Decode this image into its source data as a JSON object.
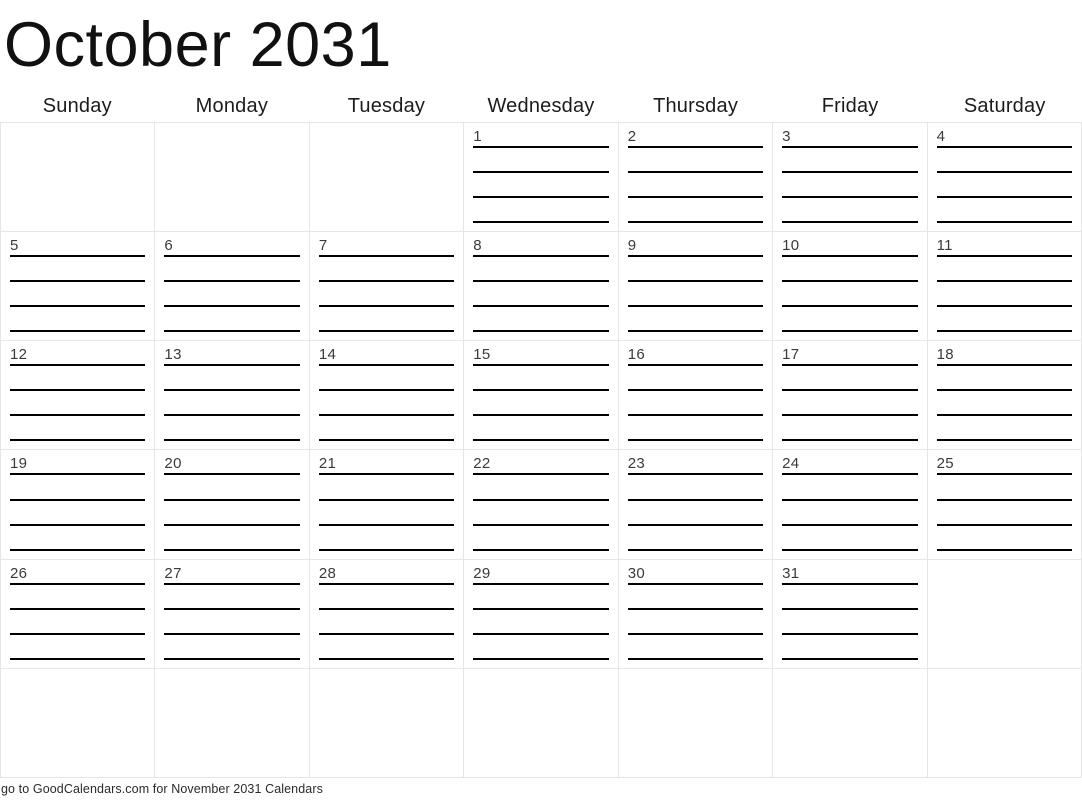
{
  "title": "October 2031",
  "month": "October",
  "year": "2031",
  "weekdays": [
    "Sunday",
    "Monday",
    "Tuesday",
    "Wednesday",
    "Thursday",
    "Friday",
    "Saturday"
  ],
  "lines_per_day": 4,
  "weeks": [
    [
      {
        "date": "",
        "has_lines": false
      },
      {
        "date": "",
        "has_lines": false
      },
      {
        "date": "",
        "has_lines": false
      },
      {
        "date": "1",
        "has_lines": true
      },
      {
        "date": "2",
        "has_lines": true
      },
      {
        "date": "3",
        "has_lines": true
      },
      {
        "date": "4",
        "has_lines": true
      }
    ],
    [
      {
        "date": "5",
        "has_lines": true
      },
      {
        "date": "6",
        "has_lines": true
      },
      {
        "date": "7",
        "has_lines": true
      },
      {
        "date": "8",
        "has_lines": true
      },
      {
        "date": "9",
        "has_lines": true
      },
      {
        "date": "10",
        "has_lines": true
      },
      {
        "date": "11",
        "has_lines": true
      }
    ],
    [
      {
        "date": "12",
        "has_lines": true
      },
      {
        "date": "13",
        "has_lines": true
      },
      {
        "date": "14",
        "has_lines": true
      },
      {
        "date": "15",
        "has_lines": true
      },
      {
        "date": "16",
        "has_lines": true
      },
      {
        "date": "17",
        "has_lines": true
      },
      {
        "date": "18",
        "has_lines": true
      }
    ],
    [
      {
        "date": "19",
        "has_lines": true
      },
      {
        "date": "20",
        "has_lines": true
      },
      {
        "date": "21",
        "has_lines": true
      },
      {
        "date": "22",
        "has_lines": true
      },
      {
        "date": "23",
        "has_lines": true
      },
      {
        "date": "24",
        "has_lines": true
      },
      {
        "date": "25",
        "has_lines": true
      }
    ],
    [
      {
        "date": "26",
        "has_lines": true
      },
      {
        "date": "27",
        "has_lines": true
      },
      {
        "date": "28",
        "has_lines": true
      },
      {
        "date": "29",
        "has_lines": true
      },
      {
        "date": "30",
        "has_lines": true
      },
      {
        "date": "31",
        "has_lines": true
      },
      {
        "date": "",
        "has_lines": false
      }
    ],
    [
      {
        "date": "",
        "has_lines": false
      },
      {
        "date": "",
        "has_lines": false
      },
      {
        "date": "",
        "has_lines": false
      },
      {
        "date": "",
        "has_lines": false
      },
      {
        "date": "",
        "has_lines": false
      },
      {
        "date": "",
        "has_lines": false
      },
      {
        "date": "",
        "has_lines": false
      }
    ]
  ],
  "footer": {
    "text": "go to GoodCalendars.com for November 2031 Calendars"
  },
  "colors": {
    "grid_line": "#e6e6e6",
    "note_line": "#000000",
    "title_text": "#111111",
    "date_text": "#3a3a3a",
    "background": "#ffffff"
  }
}
